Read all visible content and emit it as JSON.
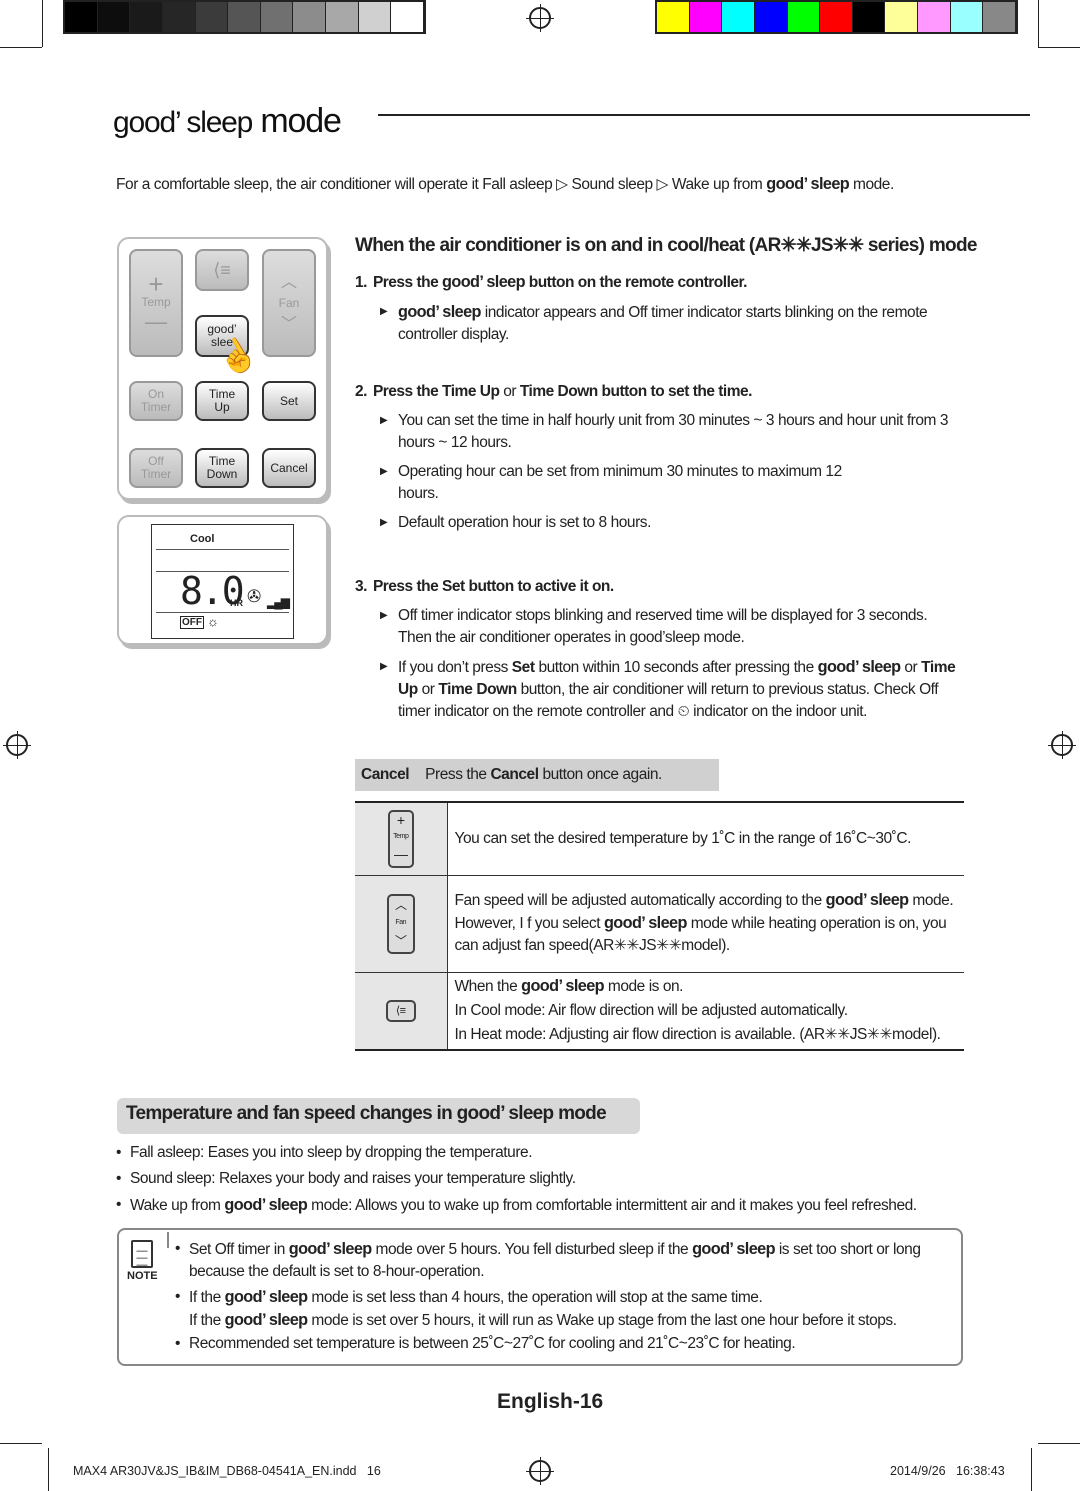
{
  "colors": {
    "grays": [
      "#000000",
      "#0d0d0d",
      "#1a1a1a",
      "#262626",
      "#3b3b3b",
      "#555555",
      "#707070",
      "#8c8c8c",
      "#a8a8a8",
      "#d0d0d0",
      "#ffffff"
    ],
    "process": [
      "#ffff00",
      "#ff00ff",
      "#00ffff",
      "#0000ff",
      "#00ff00",
      "#ff0000",
      "#000000",
      "#ffff99",
      "#ff99ff",
      "#99ffff",
      "#888888"
    ]
  },
  "title": {
    "brand": "good’ sleep",
    "suffix": "mode"
  },
  "intro": {
    "text": "For a comfortable sleep, the air conditioner will operate it Fall asleep ▷ Sound sleep ▷ Wake up from",
    "brand": "good’ sleep",
    "end": "mode."
  },
  "remote": {
    "temp": "Temp",
    "fan": "Fan",
    "good_sleep": "good’ slee",
    "on_timer": "On Timer",
    "time_up": "Time Up",
    "set": "Set",
    "off_timer": "Off Timer",
    "time_down": "Time Down",
    "cancel": "Cancel"
  },
  "display": {
    "mode": "Cool",
    "digits": "8.0",
    "unit": "HR",
    "off": "OFF"
  },
  "section1": {
    "heading": "When the air conditioner is on and in cool/heat (AR✳✳JS✳✳ series) mode",
    "step1": {
      "num": "1.",
      "pre": "Press the",
      "brand": "good’ sleep",
      "post": "button on the remote controller.",
      "b1": {
        "brand": "good’ sleep",
        "text": "indicator appears and Off timer indicator starts blinking on the remote controller display."
      }
    },
    "step2": {
      "num": "2.",
      "pre": "Press the",
      "b1": "Time Up",
      "mid": "or",
      "b2": "Time Down",
      "post": "button to set the time.",
      "bullets": [
        "You can set the time in half hourly unit from 30 minutes ~ 3 hours and hour unit from 3 hours ~ 12 hours.",
        "Operating hour can be set from minimum 30 minutes to maximum 12 hours.",
        "Default operation hour is set to 8 hours."
      ]
    },
    "step3": {
      "num": "3.",
      "pre": "Press the",
      "b": "Set",
      "post": "button to active it on.",
      "b1": "Off timer indicator stops blinking and reserved time will be displayed for 3 seconds. Then the air conditioner operates in good’sleep mode.",
      "b2": {
        "t1": "If you don’t press",
        "set": "Set",
        "t2": "button within 10 seconds after pressing the",
        "brand": "good’ sleep",
        "t3": "or",
        "tu": "Time Up",
        "t4": "or",
        "td": "Time Down",
        "t5": "button, the air conditioner will return to previous status. Check Off timer indicator on the remote controller and",
        "t6": "indicator on the indoor unit."
      }
    },
    "cancel": {
      "label": "Cancel",
      "pre": "Press the",
      "b": "Cancel",
      "post": "button once again."
    }
  },
  "table": {
    "row1": {
      "icon_label": "Temp",
      "text": "You can set the desired temperature by 1˚C in the range of 16˚C~30˚C."
    },
    "row2": {
      "icon_label": "Fan",
      "t1": "Fan speed will be adjusted automatically according to the",
      "brand": "good’ sleep",
      "t2": "mode.",
      "t3": "However, I f you select",
      "t4": "mode while heating operation is on, you can adjust fan speed(AR✳✳JS✳✳model)."
    },
    "row3": {
      "t1": "When the",
      "brand": "good’ sleep",
      "t2": "mode is on.",
      "l2": "In Cool mode: Air flow direction will be adjusted automatically.",
      "l3": "In Heat mode: Adjusting air flow direction is available. (AR✳✳JS✳✳model)."
    }
  },
  "section2": {
    "heading": "Temperature and fan speed changes in",
    "brand": "good’ sleep",
    "suffix": "mode",
    "b1": "Fall asleep: Eases you into sleep by dropping the temperature.",
    "b2": "Sound sleep: Relaxes your body and raises your temperature slightly.",
    "b3": {
      "pre": "Wake up from",
      "brand": "good’ sleep",
      "post": "mode: Allows you to wake up from comfortable intermittent air and it makes you feel refreshed."
    }
  },
  "note": {
    "label": "NOTE",
    "brand": "good’ sleep",
    "n1": {
      "t1": "Set Off timer in",
      "t2": "mode over 5 hours. You fell disturbed sleep if the",
      "t3": "is set too short or long because the default is set to 8-hour-operation."
    },
    "n2": {
      "t1": "If the",
      "t2": "mode is set less than 4 hours, the operation will stop at the same time.",
      "t3": "If the",
      "t4": "mode is set over 5 hours, it will run as Wake up stage from the last one hour before it stops."
    },
    "n3": "Recommended set temperature is between 25˚C~27˚C for cooling and 21˚C~23˚C for heating."
  },
  "page_label": "English-16",
  "footer": {
    "file": "MAX4 AR30JV&JS_IB&IM_DB68-04541A_EN.indd   16",
    "date": "2014/9/26",
    "time": "16:38:43"
  }
}
